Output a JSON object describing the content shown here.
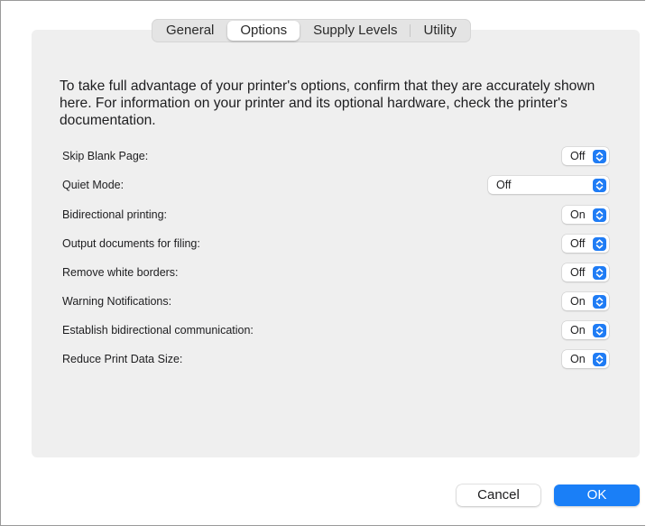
{
  "tabs": [
    "General",
    "Options",
    "Supply Levels",
    "Utility"
  ],
  "active_tab": "Options",
  "intro_text": "To take full advantage of your printer's options, confirm that they are accurately shown here. For information on your printer and its optional hardware, check the printer's documentation.",
  "options": [
    {
      "label": "Skip Blank Page:",
      "value": "Off"
    },
    {
      "label": "Quiet Mode:",
      "value": "Off"
    },
    {
      "label": "Bidirectional printing:",
      "value": "On"
    },
    {
      "label": "Output documents for filing:",
      "value": "Off"
    },
    {
      "label": "Remove white borders:",
      "value": "Off"
    },
    {
      "label": "Warning Notifications:",
      "value": "On"
    },
    {
      "label": "Establish bidirectional communication:",
      "value": "On"
    },
    {
      "label": "Reduce Print Data Size:",
      "value": "On"
    }
  ],
  "buttons": {
    "cancel": "Cancel",
    "ok": "OK"
  },
  "colors": {
    "accent": "#1a7ff7",
    "panel": "#efefef"
  },
  "icons": {
    "popup_arrows": "up-down-chevron-icon"
  }
}
